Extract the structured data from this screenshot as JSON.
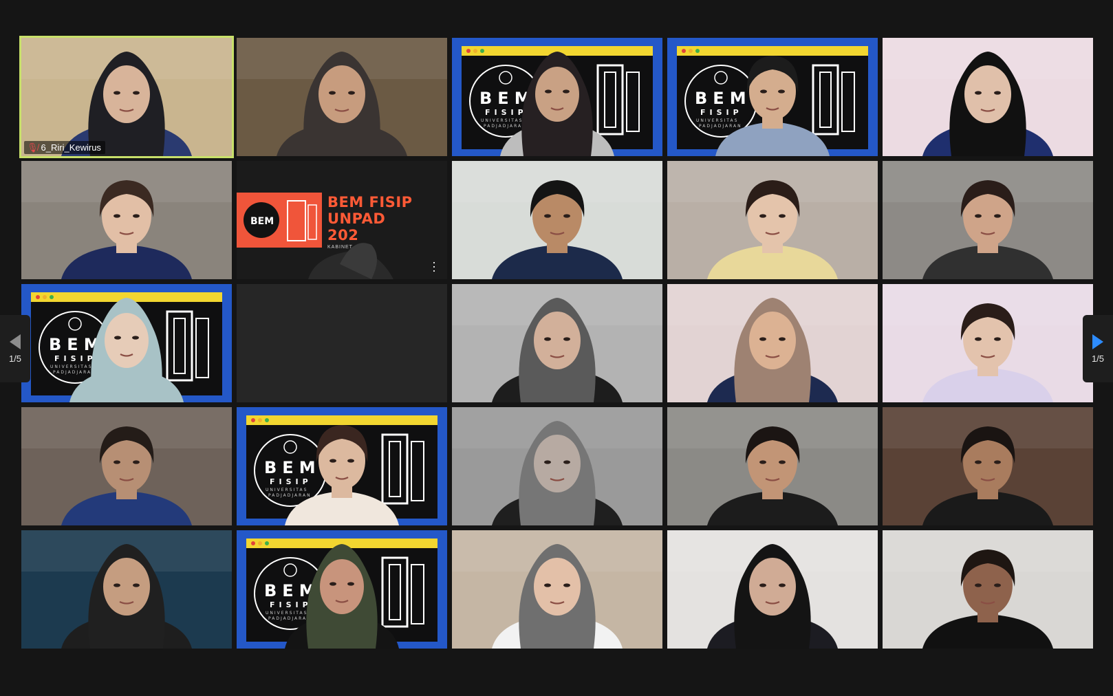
{
  "meeting": {
    "page_indicator_left": "1/5",
    "page_indicator_right": "1/5",
    "accent_color": "#2d8cff",
    "active_speaker_border": "#c8e06a"
  },
  "active_speaker": {
    "name": "6_Riri_Kewirus",
    "mic_state": "muted"
  },
  "shared_slide": {
    "title_line1": "BEM FISIP",
    "title_line2": "UNPAD",
    "title_line3": "202",
    "subtitle": "KABINET",
    "logo_text": "BEM"
  },
  "virtual_background": {
    "brand": "BEM",
    "sub_lines": [
      "FISIP",
      "UNIVERSITAS",
      "PADJADJARAN"
    ]
  },
  "tiles": [
    {
      "kind": "person",
      "bg": "#c9b58f",
      "skin": "#d8b49a",
      "wrap": "#1f1f24",
      "shirt": "#2a3a70",
      "hijab": true
    },
    {
      "kind": "person",
      "bg": "#6b5a44",
      "skin": "#c79c7e",
      "wrap": "#3a3432",
      "shirt": "#3a3432",
      "hijab": true
    },
    {
      "kind": "bem",
      "skin": "#c9a184",
      "wrap": "#262022",
      "shirt": "#bdbdbd",
      "hijab": true
    },
    {
      "kind": "bem",
      "skin": "#d4ad8e",
      "wrap": "#1c1c1c",
      "shirt": "#8fa2c0",
      "hijab": false
    },
    {
      "kind": "person",
      "bg": "#ecdbe2",
      "skin": "#e0c0aa",
      "wrap": "#111111",
      "shirt": "#1f2f6e",
      "hijab": true
    },
    {
      "kind": "person",
      "bg": "#8a847c",
      "skin": "#e2bfa6",
      "wrap": "#3b2a22",
      "shirt": "#1e2a5c",
      "hijab": false
    },
    {
      "kind": "slide"
    },
    {
      "kind": "person",
      "bg": "#d8dcd8",
      "skin": "#b98a66",
      "wrap": "#141414",
      "shirt": "#1c2a4a",
      "hijab": false
    },
    {
      "kind": "person",
      "bg": "#b9afa6",
      "skin": "#e4c4ab",
      "wrap": "#2b1d18",
      "shirt": "#e8d89a",
      "hijab": false
    },
    {
      "kind": "person",
      "bg": "#8d8a86",
      "skin": "#cfa489",
      "wrap": "#2a1d19",
      "shirt": "#303030",
      "hijab": false
    },
    {
      "kind": "bem",
      "skin": "#e6ccb8",
      "wrap": "#a8c2c6",
      "shirt": "#a8c2c6",
      "hijab": true
    },
    {
      "kind": "empty"
    },
    {
      "kind": "person",
      "bg": "#b3b3b3",
      "skin": "#d2b09a",
      "wrap": "#5a5a5a",
      "shirt": "#1d1d1d",
      "hijab": true
    },
    {
      "kind": "person",
      "bg": "#e2d3d3",
      "skin": "#dcb293",
      "wrap": "#9e8272",
      "shirt": "#1d2a50",
      "hijab": true
    },
    {
      "kind": "person",
      "bg": "#e9dbe6",
      "skin": "#e3c3ad",
      "wrap": "#2a1d19",
      "shirt": "#d9d0ea",
      "hijab": false
    },
    {
      "kind": "person",
      "bg": "#6e625a",
      "skin": "#b78f74",
      "wrap": "#241c18",
      "shirt": "#233a7a",
      "hijab": false
    },
    {
      "kind": "bem",
      "skin": "#dcb99f",
      "wrap": "#3a2620",
      "shirt": "#f0e7dd",
      "hijab": false
    },
    {
      "kind": "person",
      "bg": "#9a9a9a",
      "skin": "#b7aaa2",
      "wrap": "#767676",
      "shirt": "#1f1f1f",
      "hijab": true
    },
    {
      "kind": "person",
      "bg": "#8b8a86",
      "skin": "#c29576",
      "wrap": "#1b1513",
      "shirt": "#1c1c1c",
      "hijab": false
    },
    {
      "kind": "person",
      "bg": "#5a4236",
      "skin": "#a97c5e",
      "wrap": "#1a1412",
      "shirt": "#1a1a1a",
      "hijab": false
    },
    {
      "kind": "person",
      "bg": "#1c3a4f",
      "skin": "#c59d80",
      "wrap": "#202020",
      "shirt": "#1e1e1e",
      "hijab": true
    },
    {
      "kind": "bem",
      "skin": "#c8947c",
      "wrap": "#3f4a35",
      "shirt": "#141414",
      "hijab": true
    },
    {
      "kind": "person",
      "bg": "#c5b6a4",
      "skin": "#e3c0a8",
      "wrap": "#6f6f6f",
      "shirt": "#f2f2f2",
      "hijab": true
    },
    {
      "kind": "person",
      "bg": "#e4e2e0",
      "skin": "#d0ab95",
      "wrap": "#141414",
      "shirt": "#1c1c22",
      "hijab": true
    },
    {
      "kind": "person",
      "bg": "#d9d7d4",
      "skin": "#8e624c",
      "wrap": "#1e1612",
      "shirt": "#111111",
      "hijab": false
    }
  ]
}
